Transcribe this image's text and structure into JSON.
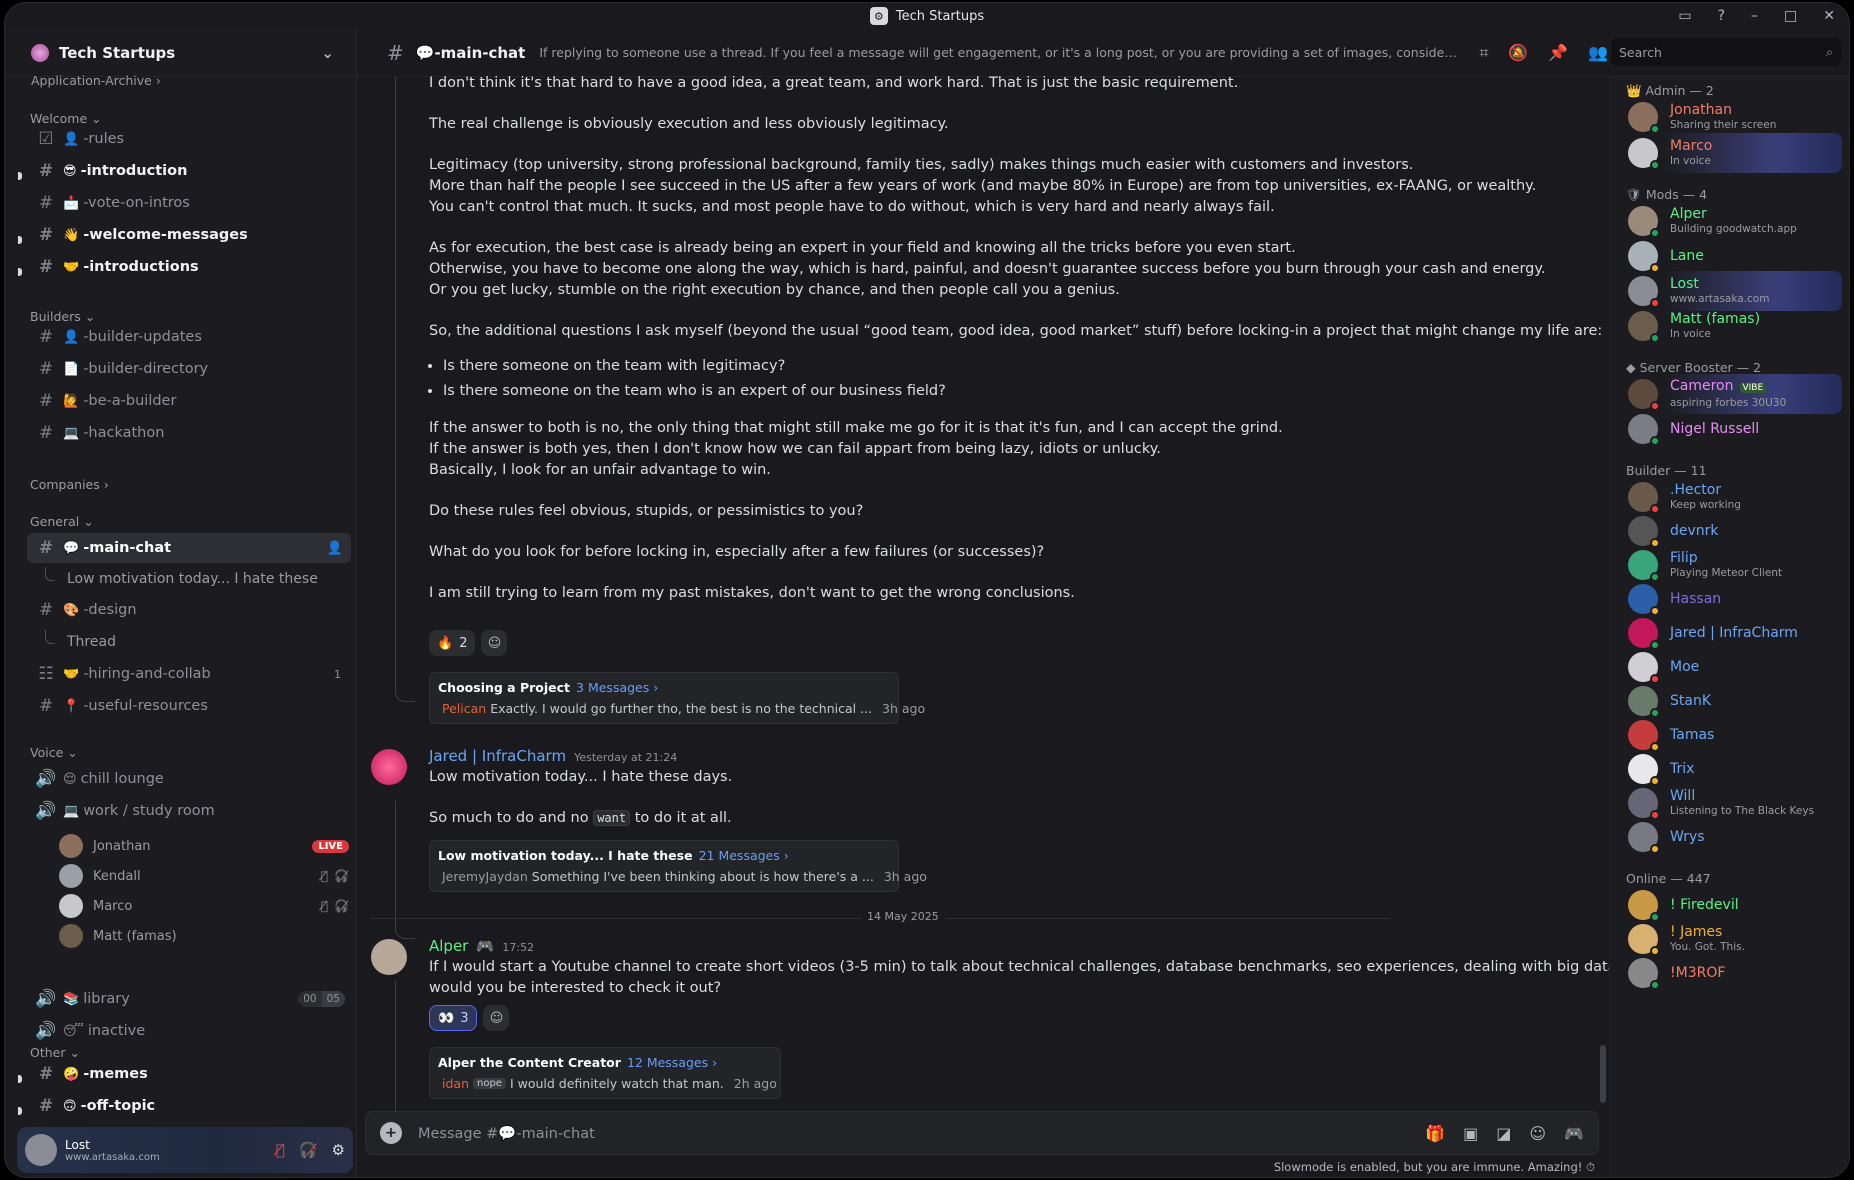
{
  "window": {
    "title": "Tech Startups"
  },
  "sidebar": {
    "guild_name": "Tech Startups",
    "top_item": "Application-Archive",
    "categories": {
      "welcome": "Welcome",
      "builders": "Builders",
      "companies": "Companies",
      "general": "General",
      "voice": "Voice",
      "other": "Other"
    },
    "channels": {
      "rules": "-rules",
      "introduction": "-introduction",
      "vote": "-vote-on-intros",
      "welcome_messages": "-welcome-messages",
      "introductions": "-introductions",
      "builder_updates": "-builder-updates",
      "builder_directory": "-builder-directory",
      "be_a_builder": "-be-a-builder",
      "hackathon": "-hackathon",
      "main_chat": "-main-chat",
      "thread1": "Low motivation today... I hate these",
      "design": "-design",
      "thread2": "Thread",
      "hiring": "-hiring-and-collab",
      "hiring_count": "1",
      "useful": "-useful-resources",
      "chill": "chill lounge",
      "work": "work / study room",
      "library": "library",
      "library_counts": [
        "00",
        "05"
      ],
      "inactive": "inactive",
      "memes": "-memes",
      "offtopic": "-off-topic"
    },
    "voice_users": [
      {
        "name": "Jonathan",
        "badge": "LIVE"
      },
      {
        "name": "Kendall"
      },
      {
        "name": "Marco"
      },
      {
        "name": "Matt (famas)"
      }
    ],
    "user_panel": {
      "name": "Lost",
      "status": "www.artasaka.com"
    }
  },
  "header": {
    "channel": "-main-chat",
    "topic": "If replying to someone use a thread. If you feel a message will get engagement, or it's a long post, or you are providing a set of images, consider creating a thread ...",
    "search_placeholder": "Search"
  },
  "messages": {
    "m1_lines": [
      "I don't think it's that hard to have a good idea, a great team, and work hard. That is just the basic requirement.",
      "The real challenge is obviously execution and less obviously legitimacy.",
      "Legitimacy (top university, strong professional background, family ties, sadly) makes things much easier with customers and investors.",
      "More than half the people I see succeed in the US after a few years of work (and maybe 80% in Europe) are from top universities, ex-FAANG, or wealthy.",
      "You can't control that much. It sucks, and most people have to do without, which is very hard and nearly always fail.",
      "As for execution, the best case is already being an expert in your field and knowing all the tricks before you even start.",
      "Otherwise, you have to become one along the way, which is hard, painful, and doesn't guarantee success before you burn through your cash and energy.",
      "Or you get lucky, stumble on the right execution by chance, and then people call you a genius.",
      "So, the additional questions I ask myself (beyond the usual “good team, good idea, good market” stuff) before locking-in a project that might change my life are:",
      "Is there someone on the team with legitimacy?",
      "Is there someone on the team who is an expert of our business field?",
      "If the answer to both is no, the only thing that might still make me go for it is that it's fun, and I can accept the grind.",
      "If the answer is both yes, then I don't know how we can fail appart from being lazy, idiots or unlucky.",
      "Basically, I look for an unfair advantage to win.",
      "Do these rules feel obvious, stupids, or pessimistics to you?",
      "What do you look for before locking in, especially after a few failures (or successes)?",
      "I am still trying to learn from my past mistakes, don't want to get the wrong conclusions."
    ],
    "m1_reaction": {
      "emoji": "🔥",
      "count": "2"
    },
    "m1_thread": {
      "title": "Choosing a Project",
      "count": "3 Messages ›",
      "author": "Pelican",
      "preview": "Exactly. I would go further tho, the best is no the technical ...",
      "time": "3h ago"
    },
    "m2": {
      "author": "Jared | InfraCharm",
      "time": "Yesterday at 21:24",
      "line1": "Low motivation today... I hate these days.",
      "line2a": "So much to do and no",
      "code": "want",
      "line2b": "to do it at all."
    },
    "m2_thread": {
      "title": "Low motivation today... I hate these",
      "count": "21 Messages ›",
      "author": "JeremyJaydan",
      "preview": "Something I've been thinking about is how there's a ...",
      "time": "3h ago"
    },
    "date_divider": "14 May 2025",
    "m3": {
      "author": "Alper",
      "time": "17:52",
      "line1": "If I would start a Youtube channel to create short videos (3-5 min) to talk about technical challenges, database benchmarks, seo experiences, dealing with big datasets, etc. -",
      "line2": "would you be interested to check it out?"
    },
    "m3_reaction": {
      "emoji": "👀",
      "count": "3"
    },
    "m3_thread": {
      "title": "Alper the Content Creator",
      "count": "12 Messages ›",
      "author": "idan",
      "tag": "nope",
      "preview": "I would definitely watch that man.",
      "time": "2h ago"
    }
  },
  "composer": {
    "placeholder": "Message #💬-main-chat",
    "slowmode": "Slowmode is enabled, but you are immune. Amazing!"
  },
  "members": {
    "groups": {
      "admin": "Admin — 2",
      "mods": "Mods — 4",
      "booster": "Server Booster — 2",
      "builder": "Builder — 11",
      "online": "Online — 447"
    },
    "list": [
      {
        "name": "Jonathan",
        "status": "Sharing their screen",
        "color": "#f47b67"
      },
      {
        "name": "Marco",
        "status": "In voice",
        "color": "#f47b67"
      },
      {
        "name": "Alper",
        "status": "Building goodwatch.app",
        "color": "#57f287"
      },
      {
        "name": "Lane",
        "status": "",
        "color": "#57f287"
      },
      {
        "name": "Lost",
        "status": "www.artasaka.com",
        "color": "#57f287"
      },
      {
        "name": "Matt (famas)",
        "status": "In voice",
        "color": "#57f287"
      },
      {
        "name": "Cameron",
        "status": "aspiring forbes 30U30",
        "color": "#e78cf5",
        "tag": "VIBE"
      },
      {
        "name": "Nigel Russell",
        "status": "",
        "color": "#e78cf5"
      },
      {
        "name": ".Hector",
        "status": "Keep working",
        "color": "#6aa6f5"
      },
      {
        "name": "devnrk",
        "status": "",
        "color": "#6aa6f5"
      },
      {
        "name": "Filip",
        "status": "Playing Meteor Client",
        "color": "#6aa6f5"
      },
      {
        "name": "Hassan",
        "status": "",
        "color": "#7d6fd6"
      },
      {
        "name": "Jared | InfraCharm",
        "status": "",
        "color": "#6aa6f5"
      },
      {
        "name": "Moe",
        "status": "",
        "color": "#6aa6f5"
      },
      {
        "name": "StanK",
        "status": "",
        "color": "#6aa6f5"
      },
      {
        "name": "Tamas",
        "status": "",
        "color": "#6aa6f5"
      },
      {
        "name": "Trix",
        "status": "",
        "color": "#6aa6f5"
      },
      {
        "name": "Will",
        "status": "Listening to The Black Keys",
        "color": "#6aa6f5"
      },
      {
        "name": "Wrys",
        "status": "",
        "color": "#6aa6f5"
      },
      {
        "name": "! Firedevil",
        "status": "",
        "color": "#57f287"
      },
      {
        "name": "! James",
        "status": "You. Got. This.",
        "color": "#f0b132"
      },
      {
        "name": "!M3ROF",
        "status": "",
        "color": "#f47b67"
      }
    ]
  }
}
